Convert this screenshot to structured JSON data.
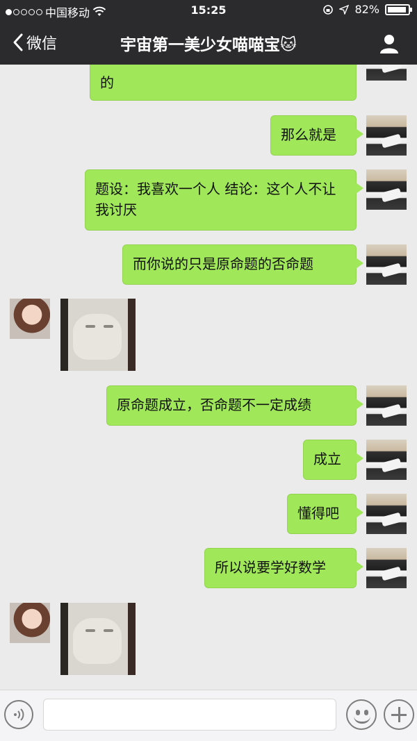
{
  "status_bar": {
    "carrier": "中国移动",
    "time": "15:25",
    "battery": "82%",
    "battery_level_percent": 82
  },
  "header": {
    "back_label": "微信",
    "title": "宇宙第一美少女喵喵宝🐱"
  },
  "messages": [
    {
      "from": "me",
      "type": "text",
      "text": "的"
    },
    {
      "from": "me",
      "type": "text",
      "text": "那么就是"
    },
    {
      "from": "me",
      "type": "text",
      "text": "题设：我喜欢一个人 结论：这个人不让我讨厌"
    },
    {
      "from": "me",
      "type": "text",
      "text": "而你说的只是原命题的否命题"
    },
    {
      "from": "her",
      "type": "sticker",
      "sticker": "white-cat-sticker"
    },
    {
      "from": "me",
      "type": "text",
      "text": "原命题成立，否命题不一定成绩"
    },
    {
      "from": "me",
      "type": "text",
      "text": "成立"
    },
    {
      "from": "me",
      "type": "text",
      "text": "懂得吧"
    },
    {
      "from": "me",
      "type": "text",
      "text": "所以说要学好数学"
    },
    {
      "from": "her",
      "type": "sticker",
      "sticker": "white-cat-sticker"
    }
  ],
  "input": {
    "value": "",
    "voice_icon": "voice-wave-icon",
    "emoji_icon": "emoji-icon",
    "plus_icon": "plus-icon"
  },
  "colors": {
    "my_bubble": "#a0e75a",
    "chat_bg": "#ebebeb",
    "header_bg": "#2b2b2e"
  }
}
